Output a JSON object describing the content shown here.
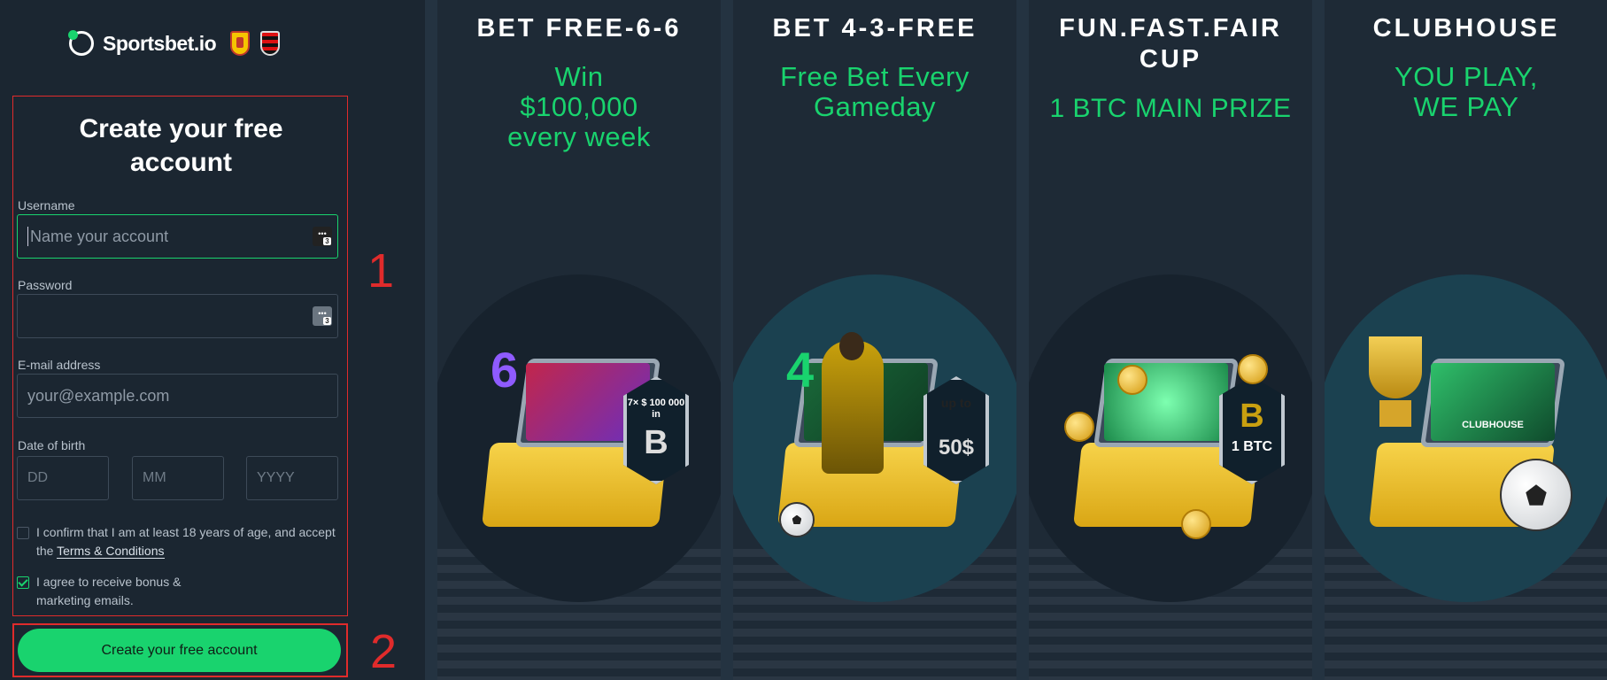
{
  "brand": {
    "logo_text": "Sportsbet.io"
  },
  "form": {
    "title": "Create your free account",
    "username_label": "Username",
    "username_placeholder": "Name your account",
    "password_label": "Password",
    "email_label": "E-mail address",
    "email_placeholder": "your@example.com",
    "dob_label": "Date of birth",
    "dob_day": "DD",
    "dob_month": "MM",
    "dob_year": "YYYY",
    "pm_badge": "3",
    "age_confirm_prefix": "I confirm that I am at least 18 years of age, and accept the ",
    "terms_link": "Terms & Conditions",
    "age_confirm_checked": false,
    "marketing_text": "I agree to receive bonus & marketing emails.",
    "marketing_checked": true,
    "submit_label": "Create your free account"
  },
  "annotations": {
    "one": "1",
    "two": "2"
  },
  "promos": [
    {
      "title": "BET FREE-6-6",
      "subtitle": "Win $100,000 every week",
      "number": "6",
      "badge_top": "7× $ 100 000 in",
      "badge_bottom": "B"
    },
    {
      "title": "BET 4-3-FREE",
      "subtitle": "Free Bet Every Gameday",
      "number": "4",
      "badge_top": "up to",
      "badge_bottom": "50$"
    },
    {
      "title": "FUN.FAST.FAIR CUP",
      "subtitle": "1 BTC MAIN PRIZE",
      "badge_top": "B",
      "badge_bottom": "1 BTC"
    },
    {
      "title": "CLUBHOUSE",
      "subtitle": "YOU PLAY, WE PAY",
      "screen_text": "CLUBHOUSE"
    }
  ],
  "colors": {
    "accent": "#19d36e",
    "annotation": "#e02b2b",
    "background": "#1b2631"
  }
}
